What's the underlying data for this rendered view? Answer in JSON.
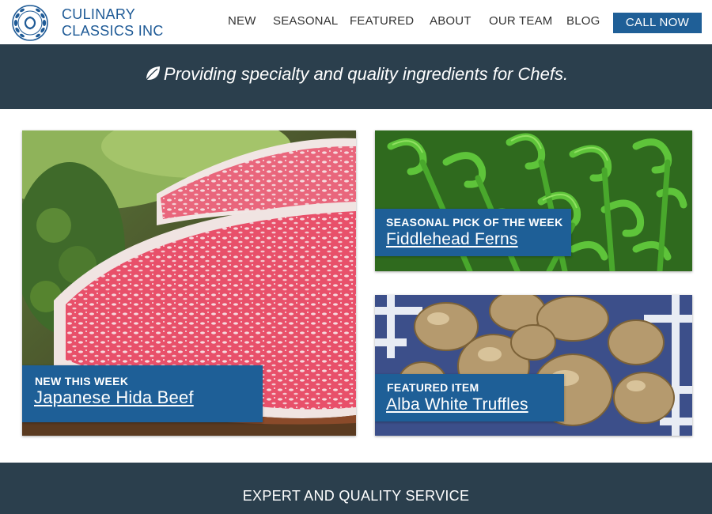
{
  "brand": {
    "line1": "CULINARY",
    "line2": "CLASSICS INC",
    "logo_icon": "cc-laurel-logo"
  },
  "nav": {
    "items": [
      {
        "label": "NEW"
      },
      {
        "label": "SEASONAL"
      },
      {
        "label": "FEATURED"
      },
      {
        "label": "ABOUT"
      },
      {
        "label": "OUR TEAM"
      },
      {
        "label": "BLOG"
      }
    ],
    "cta_label": "CALL NOW"
  },
  "banner": {
    "tagline": "Providing specialty and quality ingredients for Chefs.",
    "icon": "leaf-icon"
  },
  "cards": {
    "new": {
      "kicker": "NEW THIS WEEK",
      "title": "Japanese Hida Beef"
    },
    "seasonal": {
      "kicker": "SEASONAL PICK OF THE WEEK",
      "title": "Fiddlehead Ferns"
    },
    "featured": {
      "kicker": "FEATURED ITEM",
      "title": "Alba White Truffles"
    }
  },
  "service": {
    "title": "EXPERT AND QUALITY SERVICE"
  },
  "colors": {
    "brand_blue": "#1e5f97",
    "dark_slate": "#2b3f4d",
    "text": "#333333"
  }
}
